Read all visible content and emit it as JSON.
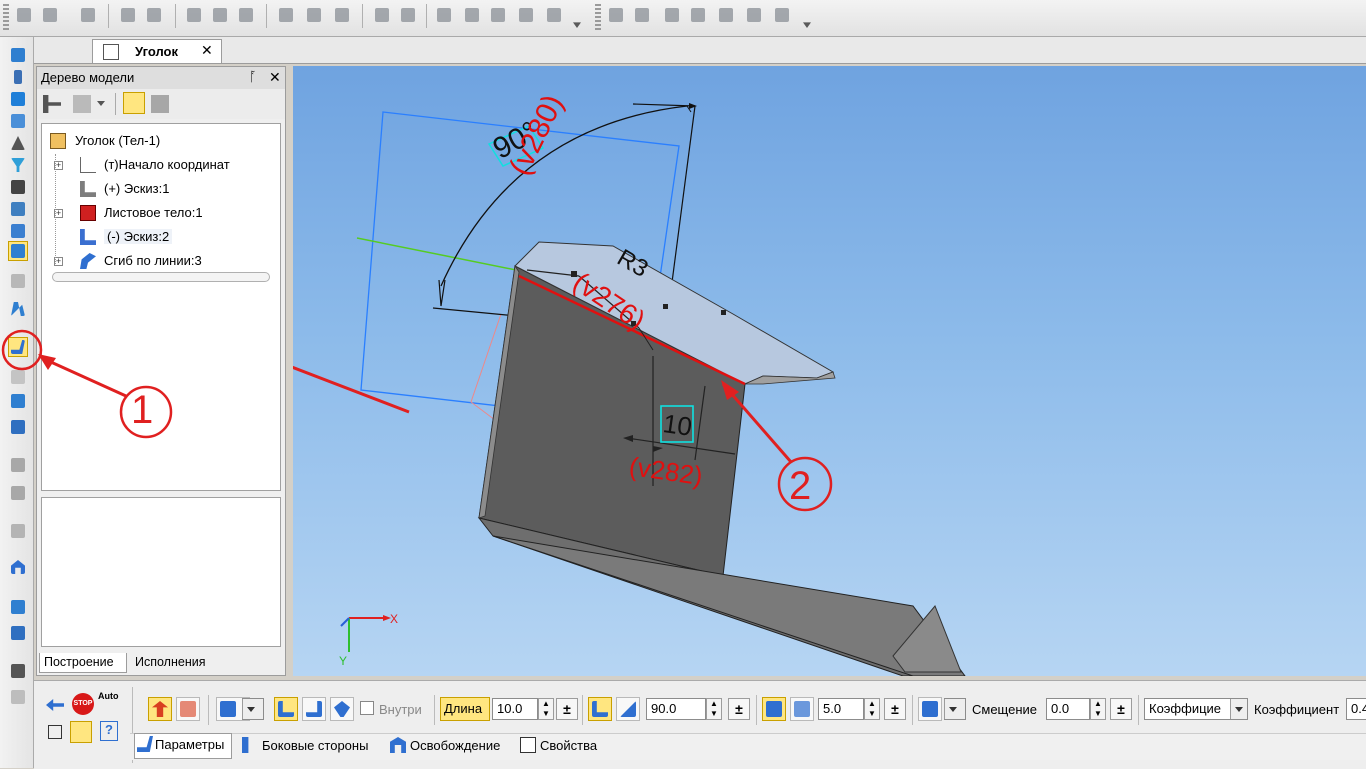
{
  "document_tab": {
    "title": "Уголок",
    "close": "✕"
  },
  "tree_panel": {
    "title": "Дерево модели",
    "pin": "ᚪ",
    "close": "✕",
    "items": [
      {
        "label": "Уголок (Тел-1)",
        "icon": "part-icon"
      },
      {
        "label": "(т)Начало координат",
        "icon": "origin-icon"
      },
      {
        "label": "(+) Эскиз:1",
        "icon": "sketch-icon"
      },
      {
        "label": "Листовое тело:1",
        "icon": "sheet-body-icon"
      },
      {
        "label": "(-) Эскиз:2",
        "icon": "sketch-icon"
      },
      {
        "label": "Сгиб по линии:3",
        "icon": "bend-line-icon"
      }
    ],
    "tabs": [
      "Построение",
      "Исполнения"
    ]
  },
  "viewport": {
    "dim_angle": "90°",
    "dim_v280": "(v280)",
    "dim_v276": "(v276)",
    "dim_radius": "R3",
    "dim_10": "10",
    "dim_v282": "(v282)",
    "axis_x": "X",
    "axis_y": "Y"
  },
  "annotations": {
    "callout_1": "1",
    "callout_2": "2"
  },
  "property_bar": {
    "auto_label": "Auto",
    "stop_label": "STOP",
    "inside_checkbox": "Внутри",
    "length_label": "Длина",
    "length_value": "10.0",
    "angle_value": "90.0",
    "radius_value": "5.0",
    "offset_label": "Смещение",
    "offset_value": "0.0",
    "coef_combo": "Коэффицие",
    "coef_label": "Коэффициент",
    "coef_value": "0.4",
    "plus_minus": "±",
    "tabs": [
      "Параметры",
      "Боковые стороны",
      "Освобождение",
      "Свойства"
    ]
  },
  "colors": {
    "accent": "#ffe680",
    "callout_red": "#e02020",
    "viewport_blue": "#7aaee6"
  }
}
